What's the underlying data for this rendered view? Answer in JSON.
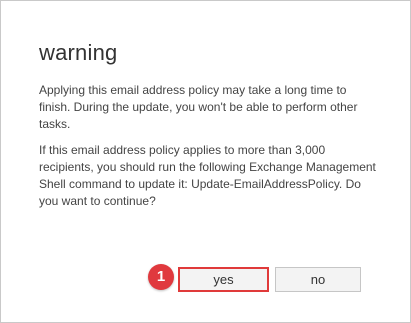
{
  "dialog": {
    "title": "warning",
    "paragraph1": "Applying this email address policy may take a long time to finish. During the update, you won't be able to perform other tasks.",
    "paragraph2": "If this email address policy applies to more than 3,000 recipients, you should run the following Exchange Management Shell command to update it: Update-EmailAddressPolicy. Do you want to continue?",
    "yes_label": "yes",
    "no_label": "no"
  },
  "annotation": {
    "step_number": "1",
    "highlight_color": "#e03a3a"
  }
}
